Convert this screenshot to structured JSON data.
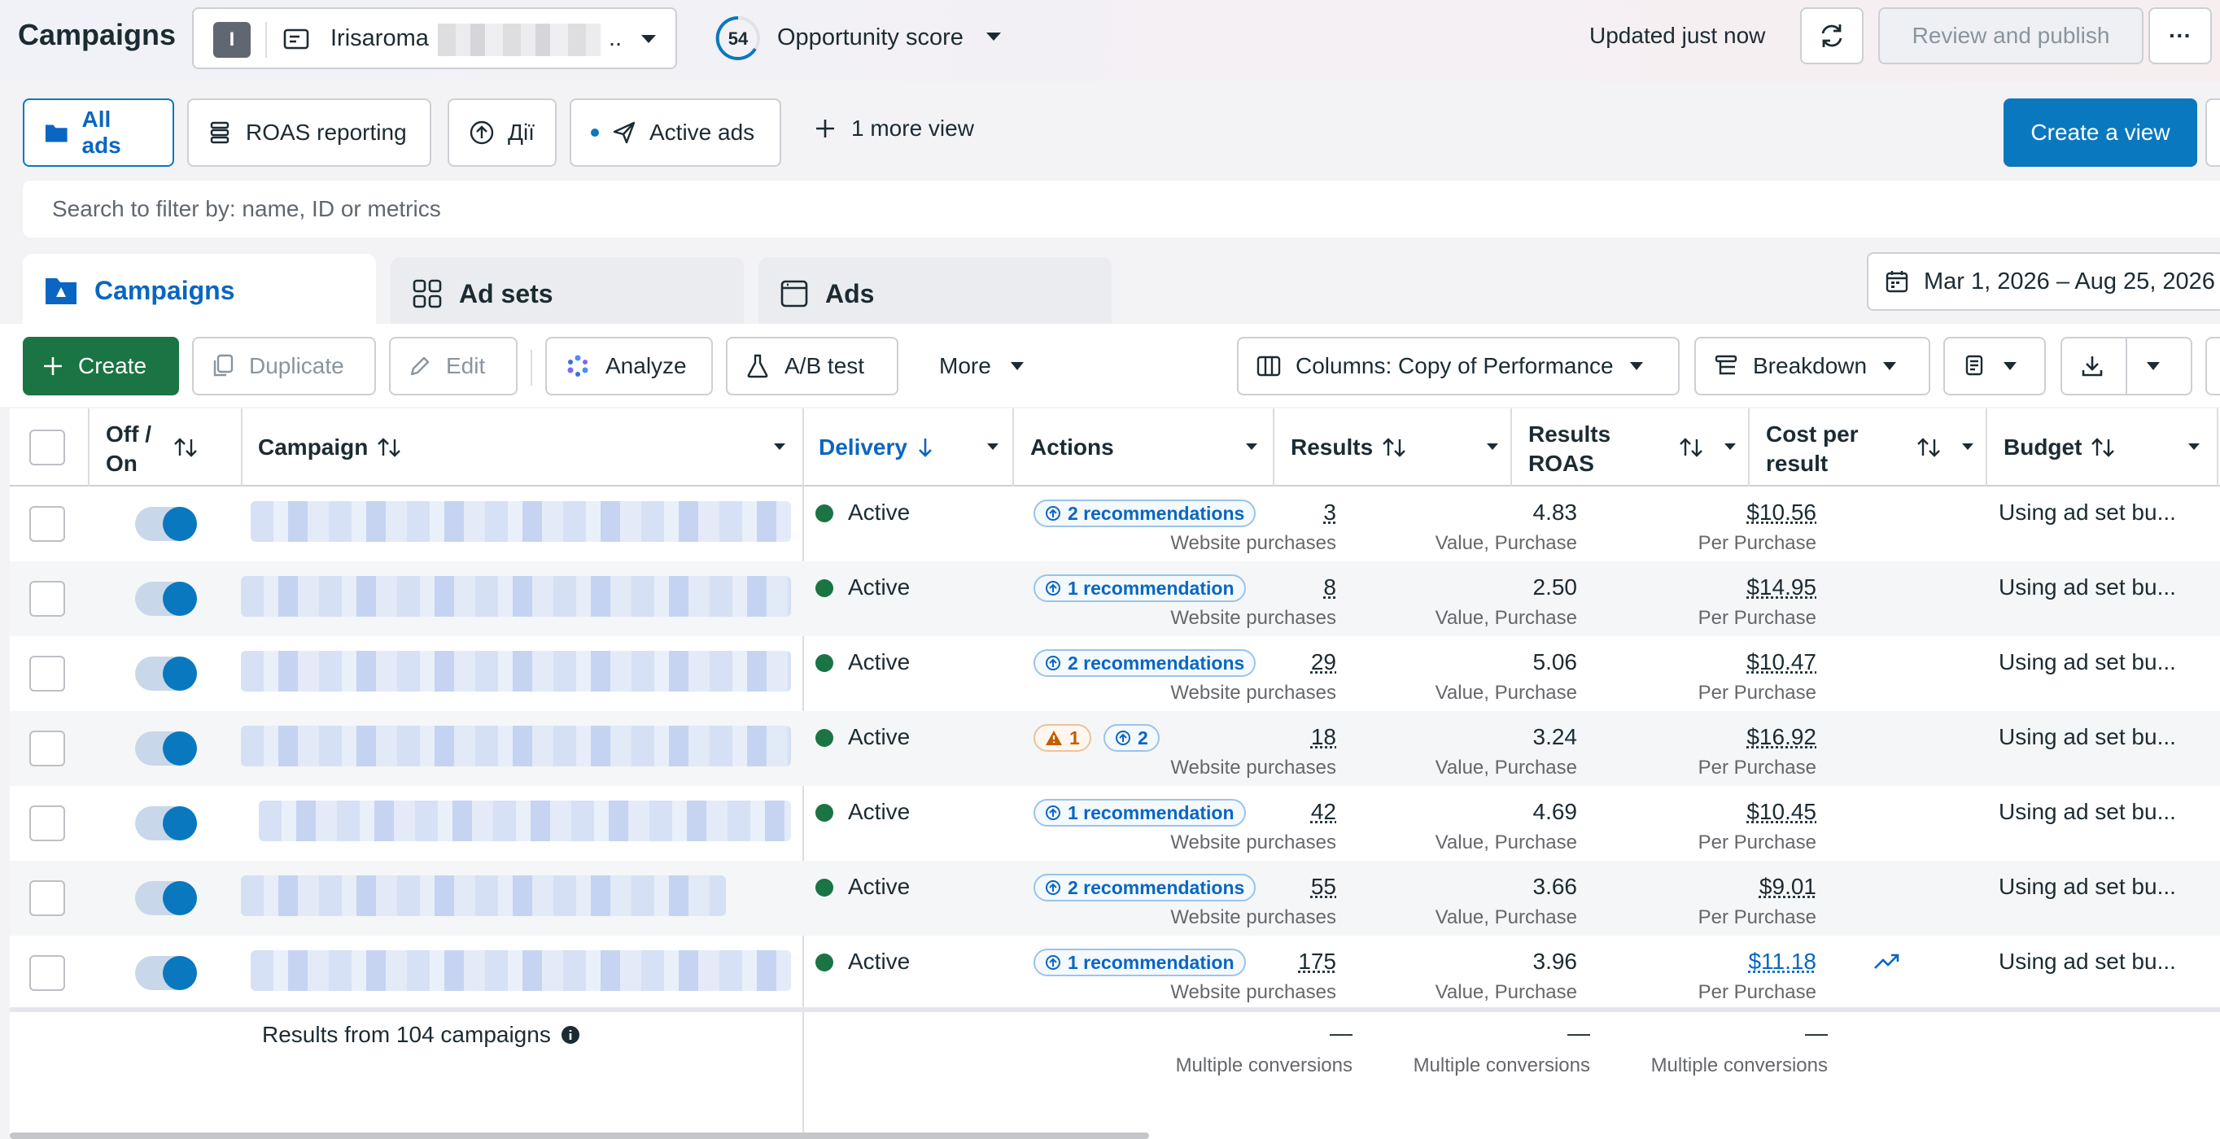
{
  "topbar": {
    "title": "Campaigns",
    "account": {
      "avatar_letter": "I",
      "name": "Irisaroma",
      "suffix": ".."
    },
    "opportunity": {
      "score": "54",
      "label": "Opportunity score"
    },
    "updated": "Updated just now",
    "review_publish": "Review and publish",
    "more_label": "···"
  },
  "views": {
    "tabs": [
      {
        "label": "All ads",
        "icon": "folder-icon"
      },
      {
        "label": "ROAS reporting",
        "icon": "stack-icon"
      },
      {
        "label": "Дії",
        "icon": "arrow-circle-icon"
      },
      {
        "label": "Active ads",
        "icon": "send-icon"
      }
    ],
    "more_views": "1 more view",
    "create_view": "Create a view"
  },
  "search": {
    "placeholder": "Search to filter by: name, ID or metrics"
  },
  "levels": {
    "tabs": [
      {
        "label": "Campaigns"
      },
      {
        "label": "Ad sets"
      },
      {
        "label": "Ads"
      }
    ]
  },
  "date_range": "Mar 1, 2026 – Aug 25, 2026",
  "toolbar": {
    "create": "Create",
    "duplicate": "Duplicate",
    "edit": "Edit",
    "analyze": "Analyze",
    "ab_test": "A/B test",
    "more": "More",
    "columns": "Columns: Copy of Performance",
    "breakdown": "Breakdown"
  },
  "table": {
    "headers": {
      "off_on": "Off /\nOn",
      "off": "Off /",
      "on": "On",
      "campaign": "Campaign",
      "delivery": "Delivery",
      "actions": "Actions",
      "results": "Results",
      "results_roas_1": "Results",
      "results_roas_2": "ROAS",
      "cost_1": "Cost per",
      "cost_2": "result",
      "budget": "Budget"
    },
    "rows": [
      {
        "delivery": "Active",
        "actions": "2 recommendations",
        "results": "3",
        "results_sub": "Website purchases",
        "roas": "4.83",
        "roas_sub": "Value, Purchase",
        "cost": "$10.56",
        "cost_sub": "Per Purchase",
        "budget": "Using ad set bu..."
      },
      {
        "delivery": "Active",
        "actions": "1 recommendation",
        "results": "8",
        "results_sub": "Website purchases",
        "roas": "2.50",
        "roas_sub": "Value, Purchase",
        "cost": "$14.95",
        "cost_sub": "Per Purchase",
        "budget": "Using ad set bu..."
      },
      {
        "delivery": "Active",
        "actions": "2 recommendations",
        "results": "29",
        "results_sub": "Website purchases",
        "roas": "5.06",
        "roas_sub": "Value, Purchase",
        "cost": "$10.47",
        "cost_sub": "Per Purchase",
        "budget": "Using ad set bu..."
      },
      {
        "delivery": "Active",
        "actions_warn": "1",
        "actions_rec": "2",
        "results": "18",
        "results_sub": "Website purchases",
        "roas": "3.24",
        "roas_sub": "Value, Purchase",
        "cost": "$16.92",
        "cost_sub": "Per Purchase",
        "budget": "Using ad set bu..."
      },
      {
        "delivery": "Active",
        "actions": "1 recommendation",
        "results": "42",
        "results_sub": "Website purchases",
        "roas": "4.69",
        "roas_sub": "Value, Purchase",
        "cost": "$10.45",
        "cost_sub": "Per Purchase",
        "budget": "Using ad set bu..."
      },
      {
        "delivery": "Active",
        "actions": "2 recommendations",
        "results": "55",
        "results_sub": "Website purchases",
        "roas": "3.66",
        "roas_sub": "Value, Purchase",
        "cost": "$9.01",
        "cost_sub": "Per Purchase",
        "budget": "Using ad set bu..."
      },
      {
        "delivery": "Active",
        "actions": "1 recommendation",
        "results": "175",
        "results_sub": "Website purchases",
        "roas": "3.96",
        "roas_sub": "Value, Purchase",
        "cost": "$11.18",
        "cost_sub": "Per Purchase",
        "budget": "Using ad set bu..."
      }
    ],
    "footer": {
      "summary": "Results from 104 campaigns",
      "results_dash": "—",
      "results_sub": "Multiple conversions",
      "roas_dash": "—",
      "roas_sub": "Multiple conversions",
      "cost_dash": "—",
      "cost_sub": "Multiple conversions"
    }
  },
  "colors": {
    "accent": "#0a78be",
    "create_green": "#1b7443",
    "active_dot": "#1b7443",
    "warning": "#c45d00"
  }
}
